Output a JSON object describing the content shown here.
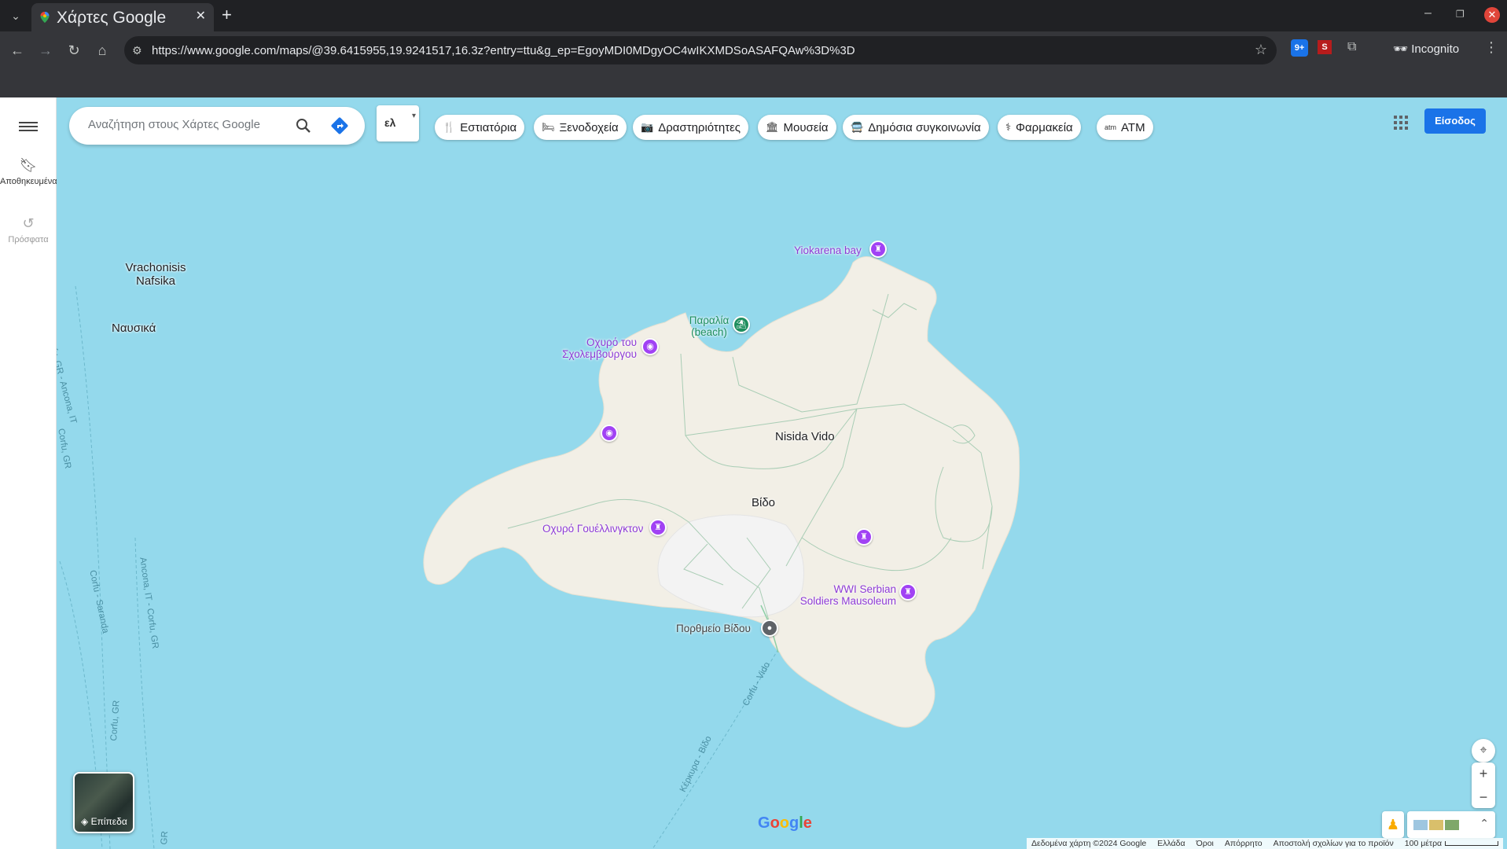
{
  "browser": {
    "tab_title": "Χάρτες Google",
    "url": "https://www.google.com/maps/@39.6415955,19.9241517,16.3z?entry=ttu&g_ep=EgoyMDI0MDgyOC4wIKXMDSoASAFQAw%3D%3D",
    "incognito_label": "Incognito",
    "ext_badge": "9+",
    "ext_s": "S"
  },
  "rail": {
    "saved_label": "Αποθηκευμένα",
    "recent_label": "Πρόσφατα"
  },
  "search": {
    "placeholder": "Αναζήτηση στους Χάρτες Google"
  },
  "lang": {
    "label": "ελ"
  },
  "chips": [
    {
      "label": "Εστιατόρια",
      "icon": "🍴"
    },
    {
      "label": "Ξενοδοχεία",
      "icon": "🛏"
    },
    {
      "label": "Δραστηριότητες",
      "icon": "📷"
    },
    {
      "label": "Μουσεία",
      "icon": "🏛"
    },
    {
      "label": "Δημόσια συγκοινωνία",
      "icon": "🚍"
    },
    {
      "label": "Φαρμακεία",
      "icon": "⚕"
    },
    {
      "label": "ATM",
      "icon": "atm"
    }
  ],
  "signin": "Είσοδος",
  "map": {
    "labels": {
      "vrachonisis": "Vrachonisis Nafsika",
      "nafsika": "Ναυσικά",
      "yiokarena": "Yiokarena bay",
      "paralia": "Παραλία (beach)",
      "ochyro_schulenburg": "Οχυρό του Σχολεμβούργου",
      "nisida_vido": "Nisida Vido",
      "vido": "Βίδο",
      "ochyro_wellington": "Οχυρό Γουέλλινγκτον",
      "serbian_mausoleum": "WWI Serbian Soldiers Mausoleum",
      "ferry": "Πορθμείο Βίδου"
    },
    "routes": {
      "corfu_ancona": "Corfu, GR - Ancona, IT",
      "corfu_gr": "Corfu, GR",
      "corfu_saranda": "Corfu - Saranda",
      "ancona_corfu": "Ancona, IT - Corfu, GR",
      "corfu_vido": "Corfu - Vido",
      "kerkyra_vido": "Κέρκυρα - Βίδο",
      "corfu_gr_bottom": "Corfu, GR",
      "corfu_gr_right": "GR"
    },
    "colors": {
      "water": "#94d9ec",
      "land": "#f2efe6",
      "poi_purple": "#8e3bd6",
      "poi_green": "#1e8e5e"
    }
  },
  "layers": {
    "label": "Επίπεδα"
  },
  "footer": {
    "data": "Δεδομένα χάρτη ©2024 Google",
    "country": "Ελλάδα",
    "terms": "Όροι",
    "privacy": "Απόρρητο",
    "feedback": "Αποστολή σχολίων για το προϊόν",
    "scale": "100 μέτρα"
  },
  "logo": {
    "g1": "G",
    "o1": "o",
    "o2": "o",
    "g2": "g",
    "l": "l",
    "e": "e"
  }
}
